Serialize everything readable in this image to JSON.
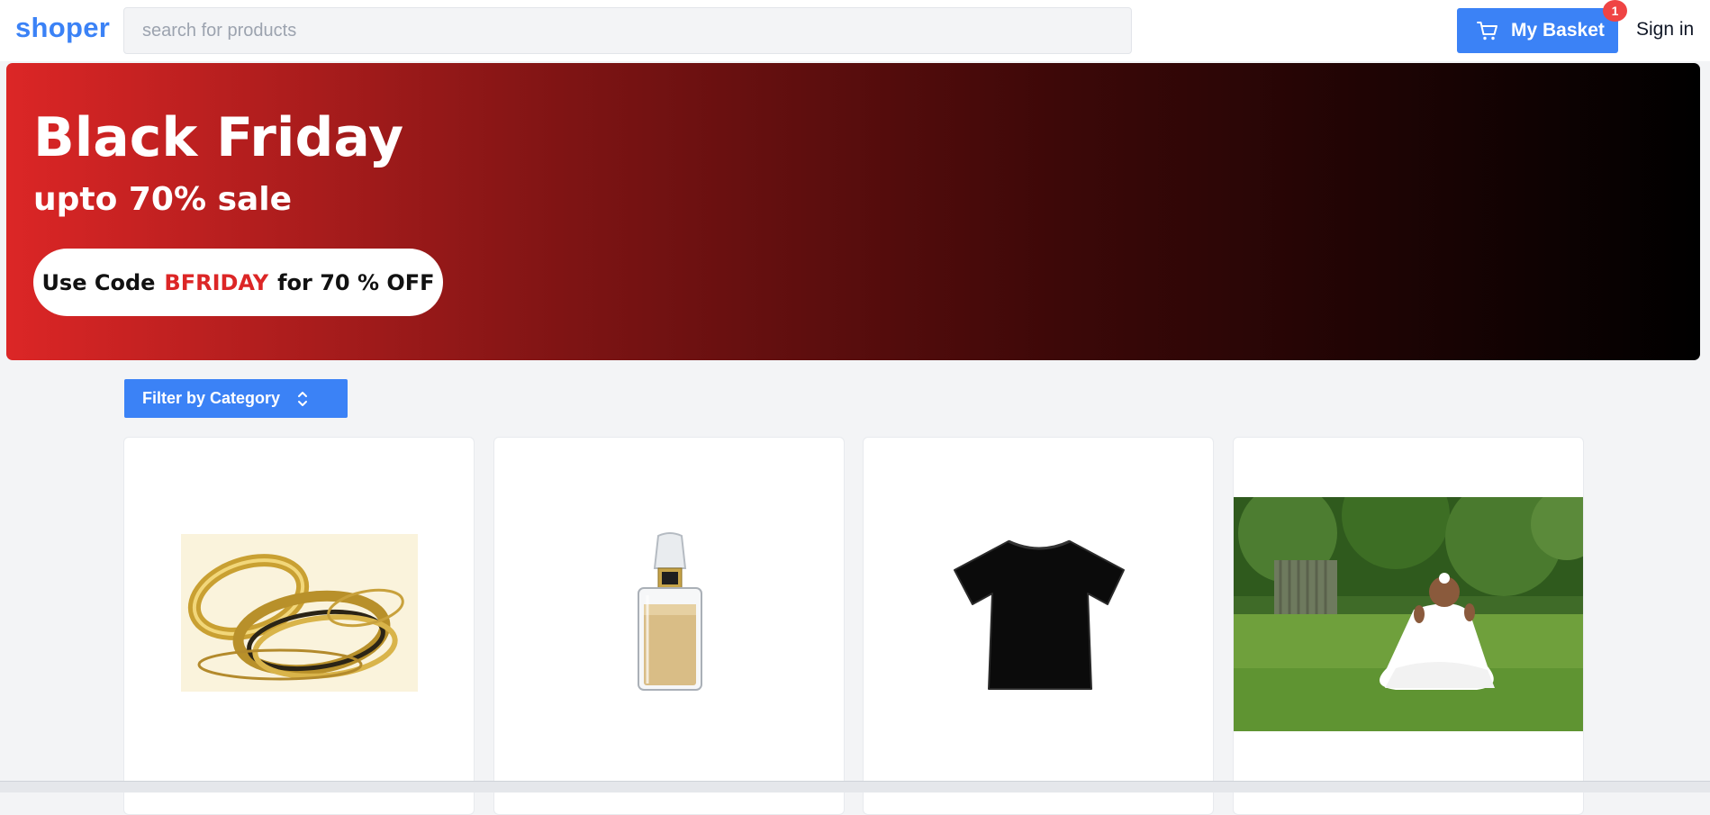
{
  "header": {
    "logo": "shoper",
    "search_placeholder": "search for products",
    "basket_label": "My Basket",
    "basket_count": "1",
    "signin_label": "Sign in"
  },
  "banner": {
    "title": "Black Friday",
    "subtitle": "upto 70% sale",
    "promo_prefix": "Use Code",
    "promo_code": "BFRIDAY",
    "promo_suffix": "for 70 % OFF"
  },
  "filter": {
    "label": "Filter by Category"
  },
  "products": [
    {
      "image": "gold-bangles-image"
    },
    {
      "image": "perfume-bottle-image"
    },
    {
      "image": "black-tshirt-image"
    },
    {
      "image": "baby-dress-photo"
    }
  ],
  "colors": {
    "accent": "#3b82f6",
    "badge": "#ef4444",
    "promo_code": "#dc2626",
    "banner_start": "#dc2626",
    "banner_end": "#000000"
  }
}
